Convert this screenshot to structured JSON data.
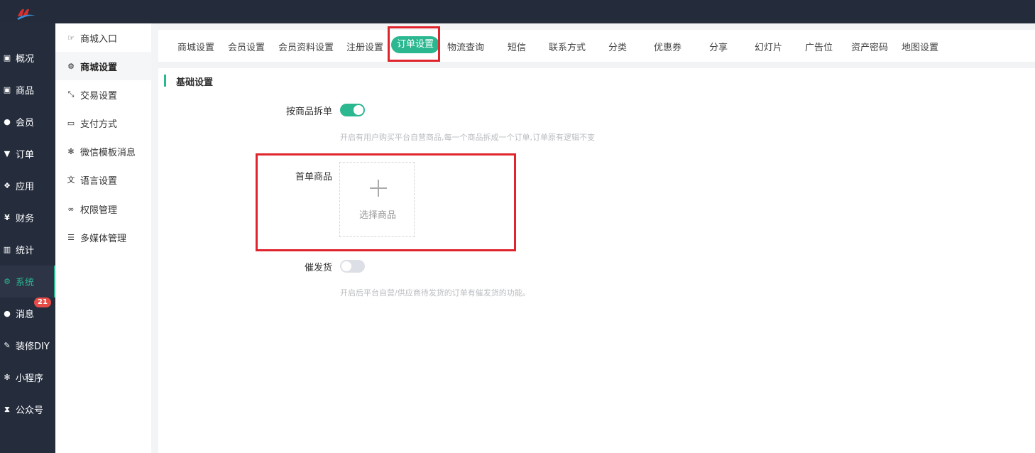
{
  "sidebar": {
    "items": [
      {
        "label": "概况",
        "icon": "dashboard-icon"
      },
      {
        "label": "商品",
        "icon": "box-icon"
      },
      {
        "label": "会员",
        "icon": "users-icon"
      },
      {
        "label": "订单",
        "icon": "cart-icon"
      },
      {
        "label": "应用",
        "icon": "apps-icon"
      },
      {
        "label": "财务",
        "icon": "yen-icon"
      },
      {
        "label": "统计",
        "icon": "chart-icon"
      },
      {
        "label": "系统",
        "icon": "gears-icon",
        "active": true
      },
      {
        "label": "消息",
        "icon": "chat-icon",
        "badge": "21"
      },
      {
        "label": "装修DIY",
        "icon": "brush-icon"
      },
      {
        "label": "小程序",
        "icon": "wechat-icon"
      },
      {
        "label": "公众号",
        "icon": "hourglass-icon"
      }
    ]
  },
  "subsidebar": {
    "items": [
      {
        "label": "商城入口",
        "icon": "hand-point-icon"
      },
      {
        "label": "商城设置",
        "icon": "gear-icon",
        "active": true
      },
      {
        "label": "交易设置",
        "icon": "arrows-icon"
      },
      {
        "label": "支付方式",
        "icon": "credit-card-icon"
      },
      {
        "label": "微信模板消息",
        "icon": "wechat-icon"
      },
      {
        "label": "语言设置",
        "icon": "translate-icon"
      },
      {
        "label": "权限管理",
        "icon": "mask-icon"
      },
      {
        "label": "多媒体管理",
        "icon": "list-icon"
      }
    ]
  },
  "tabs": [
    "商城设置",
    "会员设置",
    "会员资料设置",
    "注册设置",
    "订单设置",
    "物流查询",
    "短信",
    "联系方式",
    "分类",
    "优惠券",
    "分享",
    "幻灯片",
    "广告位",
    "资产密码",
    "地图设置"
  ],
  "active_tab": "订单设置",
  "section": {
    "title": "基础设置"
  },
  "form": {
    "split_label": "按商品拆单",
    "split_on": true,
    "split_help": "开启有用户购买平台自营商品,每一个商品拆成一个订单,订单原有逻辑不变",
    "first_label": "首单商品",
    "select_product": "选择商品",
    "urge_label": "催发货",
    "urge_on": false,
    "urge_help": "开启后平台自营/供应商待发货的订单有催发货的功能。"
  },
  "colors": {
    "accent": "#2bb890",
    "sidebar": "#252d3d",
    "highlight": "#e0242c"
  }
}
